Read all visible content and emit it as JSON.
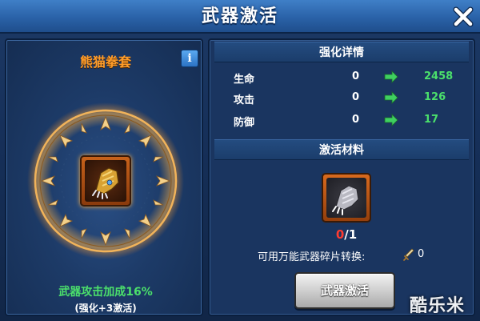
{
  "header": {
    "title": "武器激活"
  },
  "weapon": {
    "name": "熊猫拳套",
    "bonus_text": "武器攻击加成16%",
    "bonus_sub": "(强化+3激活)"
  },
  "details": {
    "section_title": "强化详情",
    "stats": [
      {
        "label": "生命",
        "from": "0",
        "to": "2458"
      },
      {
        "label": "攻击",
        "from": "0",
        "to": "126"
      },
      {
        "label": "防御",
        "from": "0",
        "to": "17"
      }
    ]
  },
  "materials": {
    "section_title": "激活材料",
    "have": "0",
    "separator": "/",
    "need": "1",
    "convert_text": "可用万能武器碎片转换:",
    "convert_count": "0"
  },
  "actions": {
    "activate_label": "武器激活"
  },
  "watermark": "酷乐米",
  "colors": {
    "accent_orange": "#ff9d2a",
    "stat_green": "#4be06b",
    "insufficient_red": "#ff3b30",
    "header_blue": "#2a62a8"
  },
  "icons": {
    "close": "close-icon",
    "info": "info-icon",
    "arrow": "arrow-right-icon",
    "weapon": "gauntlet-icon",
    "material": "gauntlet-fragment-icon",
    "convert": "sword-icon"
  }
}
